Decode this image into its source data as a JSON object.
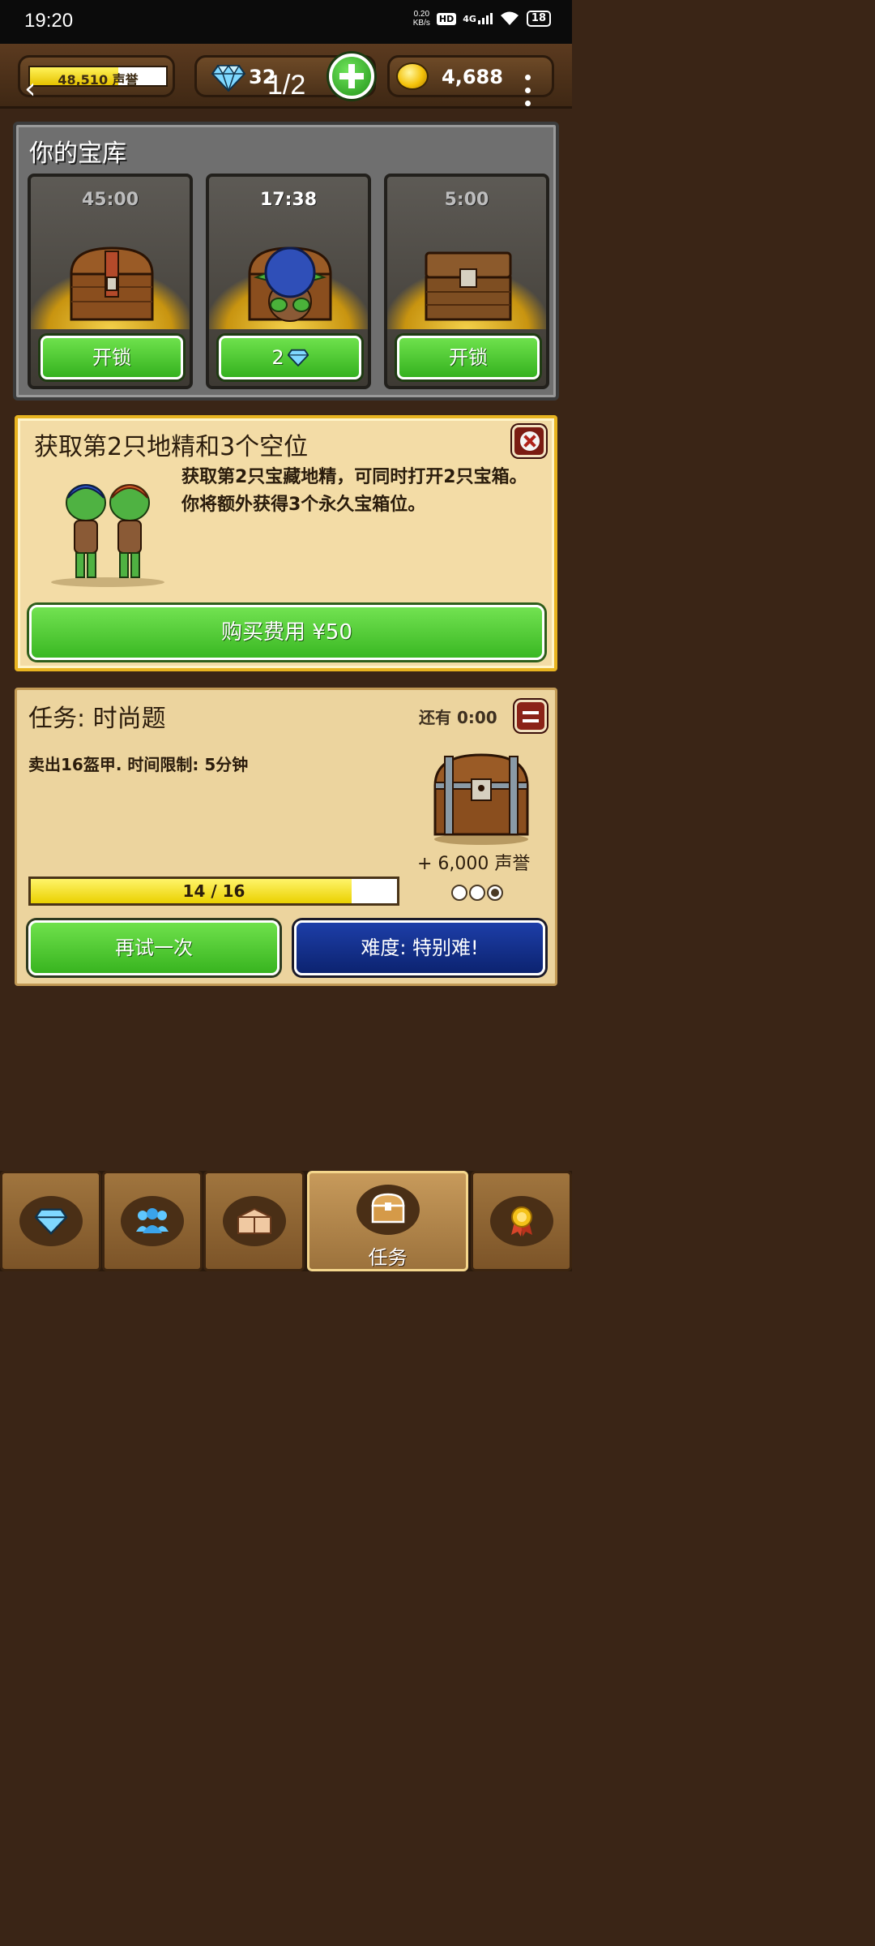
{
  "status_bar": {
    "time": "19:20",
    "net_speed": "0.20",
    "net_unit": "KB/s",
    "hd": "HD",
    "network": "4G",
    "battery": "18"
  },
  "top_bar": {
    "reputation_text": "48,510 声誉",
    "reputation_fraction": 0.65,
    "gems": "32",
    "page_indicator": "1/2",
    "gold": "4,688"
  },
  "vault": {
    "title": "你的宝库",
    "slots": [
      {
        "timer": "45:00",
        "button": "开锁",
        "icon": "wooden-chest"
      },
      {
        "timer": "17:38",
        "button": "2",
        "button_icon": "gem-icon",
        "icon": "goblin-on-chest"
      },
      {
        "timer": "5:00",
        "button": "开锁",
        "icon": "plain-chest"
      }
    ]
  },
  "offer": {
    "title": "获取第2只地精和3个空位",
    "description": "获取第2只宝藏地精，可同时打开2只宝箱。你将额外获得3个永久宝箱位。",
    "buy_button": "购买费用 ¥50"
  },
  "quest": {
    "title": "任务: 时尚题",
    "remaining": "还有 0:00",
    "task": "卖出16盔甲. 时间限制: 5分钟",
    "reward": "+ 6,000 声誉",
    "progress_text": "14 / 16",
    "progress_fraction": 0.875,
    "difficulty_dots_filled": 1,
    "difficulty_dots_total": 3,
    "retry_button": "再试一次",
    "difficulty_button": "难度: 特别难!"
  },
  "bottom_nav": {
    "tabs": [
      {
        "icon": "gem-icon",
        "label": ""
      },
      {
        "icon": "people-icon",
        "label": ""
      },
      {
        "icon": "crate-icon",
        "label": ""
      },
      {
        "icon": "chest-icon",
        "label": "任务",
        "active": true
      },
      {
        "icon": "medal-icon",
        "label": ""
      }
    ]
  },
  "colors": {
    "green_button": "#44c12a",
    "blue_button": "#12308a",
    "gold_border": "#e8b420",
    "progress_yellow": "#f2dc1a"
  }
}
